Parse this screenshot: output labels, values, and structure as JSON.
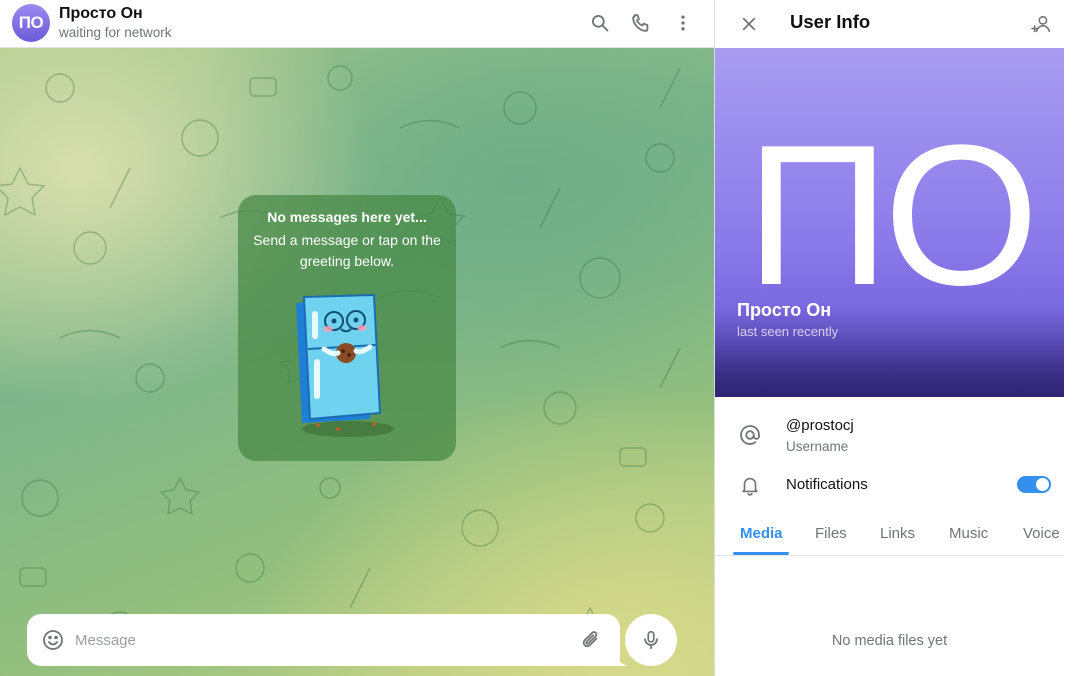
{
  "chat": {
    "avatar_initials": "ПО",
    "peer_name": "Просто Он",
    "peer_status": "waiting for network",
    "header_icons": [
      "search-icon",
      "phone-icon",
      "more-vertical-icon"
    ],
    "empty_title": "No messages here yet...",
    "empty_text": "Send a message or tap on the greeting below.",
    "sticker": "fridge-sticker",
    "composer": {
      "placeholder": "Message",
      "value": ""
    }
  },
  "panel": {
    "title": "User Info",
    "photo_initials": "ПО",
    "name": "Просто Он",
    "status": "last seen recently",
    "username": "@prostocj",
    "username_label": "Username",
    "notifications_label": "Notifications",
    "notifications_enabled": true,
    "tabs": [
      {
        "label": "Media",
        "active": true
      },
      {
        "label": "Files",
        "active": false
      },
      {
        "label": "Links",
        "active": false
      },
      {
        "label": "Music",
        "active": false
      },
      {
        "label": "Voice",
        "active": false
      }
    ],
    "empty_media": "No media files yet"
  },
  "colors": {
    "accent": "#3390ec",
    "avatar_gradient_top": "#9b8bf0",
    "avatar_gradient_bottom": "#6b5bd9",
    "card": "#4a8947"
  }
}
